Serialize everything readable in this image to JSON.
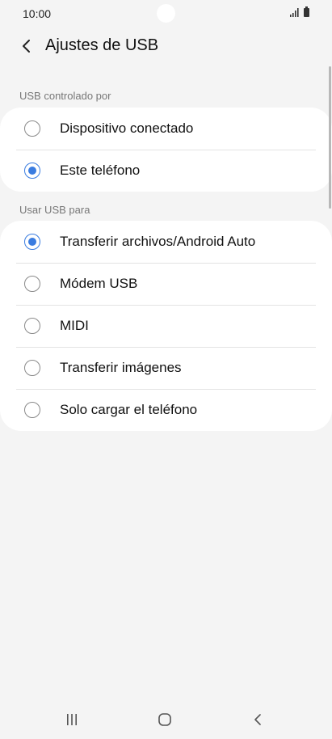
{
  "status_bar": {
    "time": "10:00",
    "icons": [
      "signal-icon",
      "battery-icon"
    ]
  },
  "header": {
    "title": "Ajustes de USB",
    "back_icon": "chevron-left-icon"
  },
  "sections": [
    {
      "label": "USB controlado por",
      "options": [
        {
          "label": "Dispositivo conectado",
          "selected": false
        },
        {
          "label": "Este teléfono",
          "selected": true
        }
      ]
    },
    {
      "label": "Usar USB para",
      "options": [
        {
          "label": "Transferir archivos/Android Auto",
          "selected": true
        },
        {
          "label": "Módem USB",
          "selected": false
        },
        {
          "label": "MIDI",
          "selected": false
        },
        {
          "label": "Transferir imágenes",
          "selected": false
        },
        {
          "label": "Solo cargar el teléfono",
          "selected": false
        }
      ]
    }
  ],
  "nav_bar": {
    "buttons": [
      "recents-icon",
      "home-icon",
      "back-icon"
    ]
  },
  "colors": {
    "accent": "#3a7ce0",
    "background": "#f4f4f4",
    "card": "#ffffff"
  }
}
